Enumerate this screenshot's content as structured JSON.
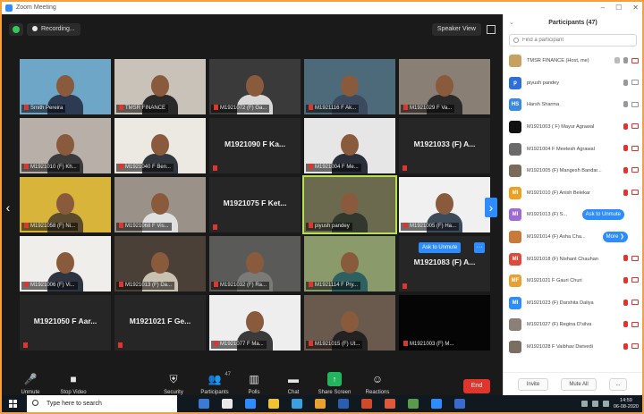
{
  "window": {
    "title": "Zoom Meeting",
    "controls": [
      "–",
      "☐",
      "✕"
    ]
  },
  "meeting": {
    "recording_label": "Recording...",
    "view_label": "Speaker View",
    "tiles": [
      {
        "name": "Smith Pereira",
        "video": true,
        "bg": "#6ea6c8",
        "shirt": "#2c3a52"
      },
      {
        "name": "TMSR FINANCE",
        "video": true,
        "bg": "#c9c2b8",
        "shirt": "#2a2a2a"
      },
      {
        "name": "M1921072 (F) Ga...",
        "video": true,
        "bg": "#3a3a3a",
        "shirt": "#d8d8d8"
      },
      {
        "name": "M1921116 F Ak...",
        "video": true,
        "bg": "#4d6a7a",
        "shirt": "#3b4a5e"
      },
      {
        "name": "M1921029 F Va...",
        "video": true,
        "bg": "#8a7f74",
        "shirt": "#2a2a2a"
      },
      {
        "name": "M1921010 (F) Kh...",
        "video": true,
        "bg": "#b8b0a8",
        "shirt": "#3a3a3a"
      },
      {
        "name": "M1921040 F Ben...",
        "video": true,
        "bg": "#ece8e2",
        "shirt": "#33383f"
      },
      {
        "name": "M1921090 F Ka...",
        "video": false
      },
      {
        "name": "M1921004 F Me...",
        "video": true,
        "bg": "#e6e6e6",
        "shirt": "#2a2f3a"
      },
      {
        "name": "M1921033 (F) A...",
        "video": false
      },
      {
        "name": "M1921058 (F) Ni...",
        "video": true,
        "bg": "#d8b43a",
        "shirt": "#5c4a2e"
      },
      {
        "name": "M1921068 F Vis...",
        "video": true,
        "bg": "#9a9288",
        "shirt": "#e0e0e0"
      },
      {
        "name": "M1921075 F Ket...",
        "video": false
      },
      {
        "name": "piyush pandey",
        "video": true,
        "bg": "#6c6a4e",
        "shirt": "#33382e",
        "active": true
      },
      {
        "name": "M1921005 (F) Ha...",
        "video": true,
        "bg": "#f0f0f0",
        "shirt": "#3c4a5a"
      },
      {
        "name": "M1921006 (F) Vi...",
        "video": true,
        "bg": "#f0eeea",
        "shirt": "#2e3440"
      },
      {
        "name": "M1921013 (F) Da...",
        "video": true,
        "bg": "#4a4038",
        "shirt": "#c9c2b0"
      },
      {
        "name": "M1921032 (F) Ra...",
        "video": true,
        "bg": "#5a5a58",
        "shirt": "#7a7a78"
      },
      {
        "name": "M1921114 F Pry...",
        "video": true,
        "bg": "#8a9a6a",
        "shirt": "#2e6060"
      },
      {
        "name": "M1921083 (F) A...",
        "video": false
      },
      {
        "name": "M1921050 F Aar...",
        "video": false
      },
      {
        "name": "M1921021 F Ge...",
        "video": false
      },
      {
        "name": "M1921077 F Ma...",
        "video": true,
        "bg": "#eeeeee",
        "shirt": "#3a3a3a"
      },
      {
        "name": "M1921015 (F) Ut...",
        "video": true,
        "bg": "#6a5a4e",
        "shirt": "#222222"
      },
      {
        "name": "M1921003 (F) M...",
        "video": true,
        "bg": "#050505",
        "shirt": "#050505"
      }
    ],
    "ask_unmute_label": "Ask to Unmute",
    "more_label": "···"
  },
  "toolbar": {
    "unmute": "Unmute",
    "stop_video": "Stop Video",
    "security": "Security",
    "participants": "Participants",
    "participants_count": "47",
    "polls": "Polls",
    "chat": "Chat",
    "share_screen": "Share Screen",
    "reactions": "Reactions",
    "end": "End"
  },
  "panel": {
    "title": "Participants (47)",
    "search_placeholder": "Find a participant",
    "participants": [
      {
        "name": "TMSR FINANCE (Host, me)",
        "avatar": "",
        "color": "#c8a060",
        "mic": "on",
        "cam": "off"
      },
      {
        "name": "piyush pandey",
        "avatar": "p",
        "color": "#2d6fd6",
        "mic": "on",
        "cam": "on"
      },
      {
        "name": "Harsh Sharma",
        "avatar": "HS",
        "color": "#3a8ae0",
        "mic": "on",
        "cam": "on"
      },
      {
        "name": "M1921003 ( F) Mayur Agrawal",
        "avatar": "",
        "color": "#111111",
        "mic": "off",
        "cam": "off"
      },
      {
        "name": "M1921004 F Meetesh Agrawal",
        "avatar": "",
        "color": "#6a6a6a",
        "mic": "off",
        "cam": "off"
      },
      {
        "name": "M1921005 (F) Mangesh Bandar...",
        "avatar": "",
        "color": "#7a6a5a",
        "mic": "off",
        "cam": "off"
      },
      {
        "name": "M1921010 (F) Anish Belekar",
        "avatar": "MI",
        "color": "#f0a020",
        "mic": "off",
        "cam": "off"
      },
      {
        "name": "M1921013 (F) S...",
        "avatar": "MI",
        "color": "#a06ad6",
        "mic": "off",
        "cam": "off",
        "button": "Ask to Unmute"
      },
      {
        "name": "M1921014 (F) Asha Cha...",
        "avatar": "",
        "color": "#c87a3a",
        "mic": "off",
        "cam": "off",
        "button": "More ❯"
      },
      {
        "name": "M1921018 (F) Nishant Chauhan",
        "avatar": "MI",
        "color": "#e04a3a",
        "mic": "off",
        "cam": "off"
      },
      {
        "name": "M1921021 F Gauri Churi",
        "avatar": "MF",
        "color": "#e8a030",
        "mic": "off",
        "cam": "off"
      },
      {
        "name": "M1921023 (F) Darshita Daliya",
        "avatar": "MI",
        "color": "#2d8cff",
        "mic": "off",
        "cam": "off"
      },
      {
        "name": "M1921027 (F) Regina D'silva",
        "avatar": "",
        "color": "#8a8078",
        "mic": "off",
        "cam": "off"
      },
      {
        "name": "M1921028 F Vaibhav Dwivedi",
        "avatar": "",
        "color": "#7a6e62",
        "mic": "off",
        "cam": "off"
      }
    ],
    "invite_label": "Invite",
    "mute_all_label": "Mute All",
    "more_label": "..."
  },
  "taskbar": {
    "search_placeholder": "Type here to search",
    "time": "14:59",
    "date": "06-08-2020",
    "app_colors": [
      "#3a7bd5",
      "#e8e8e8",
      "#2d8cff",
      "#f2c230",
      "#3aa0e0",
      "#e8a030",
      "#2a5fb0",
      "#d04a2a",
      "#e05a3a",
      "#5a9a4a",
      "#2d8cff",
      "#3a6ad0"
    ]
  }
}
